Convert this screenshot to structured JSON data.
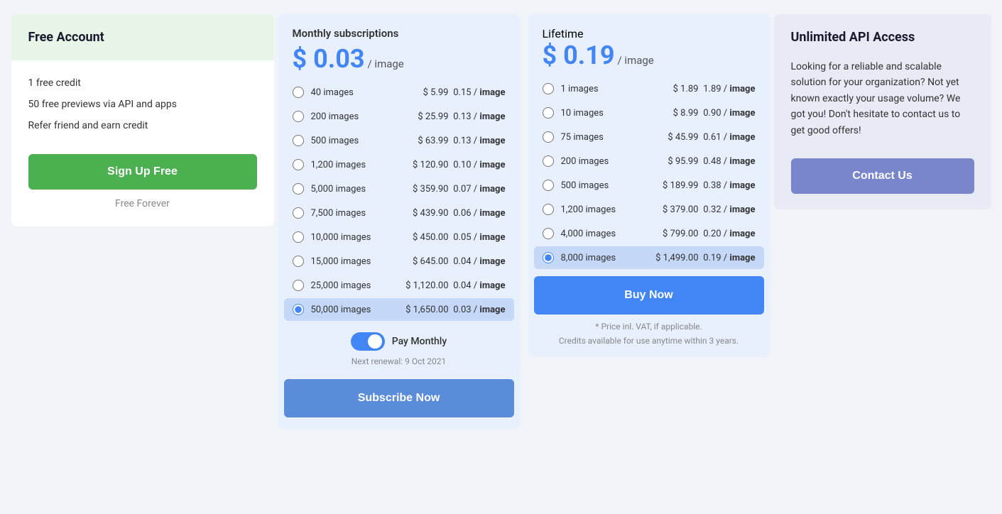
{
  "free": {
    "header": "Free Account",
    "features": [
      "1 free credit",
      "50 free previews via API and apps",
      "Refer friend and earn credit"
    ],
    "signup_label": "Sign Up Free",
    "forever_label": "Free Forever"
  },
  "monthly": {
    "title": "Monthly subscriptions",
    "price": "$ 0.03",
    "price_unit": "/ image",
    "rows": [
      {
        "images": "40 images",
        "price": "$ 5.99",
        "per_image": "0.15",
        "selected": false
      },
      {
        "images": "200 images",
        "price": "$ 25.99",
        "per_image": "0.13",
        "selected": false
      },
      {
        "images": "500 images",
        "price": "$ 63.99",
        "per_image": "0.13",
        "selected": false
      },
      {
        "images": "1,200 images",
        "price": "$ 120.90",
        "per_image": "0.10",
        "selected": false
      },
      {
        "images": "5,000 images",
        "price": "$ 359.90",
        "per_image": "0.07",
        "selected": false
      },
      {
        "images": "7,500 images",
        "price": "$ 439.90",
        "per_image": "0.06",
        "selected": false
      },
      {
        "images": "10,000 images",
        "price": "$ 450.00",
        "per_image": "0.05",
        "selected": false
      },
      {
        "images": "15,000 images",
        "price": "$ 645.00",
        "per_image": "0.04",
        "selected": false
      },
      {
        "images": "25,000 images",
        "price": "$ 1,120.00",
        "per_image": "0.04",
        "selected": false
      },
      {
        "images": "50,000 images",
        "price": "$ 1,650.00",
        "per_image": "0.03",
        "selected": true
      }
    ],
    "toggle_label": "Pay Monthly",
    "renewal_text": "Next renewal: 9 Oct 2021",
    "subscribe_label": "Subscribe Now"
  },
  "lifetime": {
    "title": "Lifetime",
    "price": "$ 0.19",
    "price_unit": "/ image",
    "rows": [
      {
        "images": "1 images",
        "price": "$ 1.89",
        "per_image": "1.89",
        "selected": false
      },
      {
        "images": "10 images",
        "price": "$ 8.99",
        "per_image": "0.90",
        "selected": false
      },
      {
        "images": "75 images",
        "price": "$ 45.99",
        "per_image": "0.61",
        "selected": false
      },
      {
        "images": "200 images",
        "price": "$ 95.99",
        "per_image": "0.48",
        "selected": false
      },
      {
        "images": "500 images",
        "price": "$ 189.99",
        "per_image": "0.38",
        "selected": false
      },
      {
        "images": "1,200 images",
        "price": "$ 379.00",
        "per_image": "0.32",
        "selected": false
      },
      {
        "images": "4,000 images",
        "price": "$ 799.00",
        "per_image": "0.20",
        "selected": false
      },
      {
        "images": "8,000 images",
        "price": "$ 1,499.00",
        "per_image": "0.19",
        "selected": true
      }
    ],
    "buy_label": "Buy Now",
    "vat_note": "* Price inl. VAT, if applicable.",
    "credits_note": "Credits available for use anytime within 3 years."
  },
  "unlimited": {
    "header": "Unlimited API Access",
    "description": "Looking for a reliable and scalable solution for your organization? Not yet known exactly your usage volume? We got you! Don't hesitate to contact us to get good offers!",
    "contact_label": "Contact Us"
  }
}
